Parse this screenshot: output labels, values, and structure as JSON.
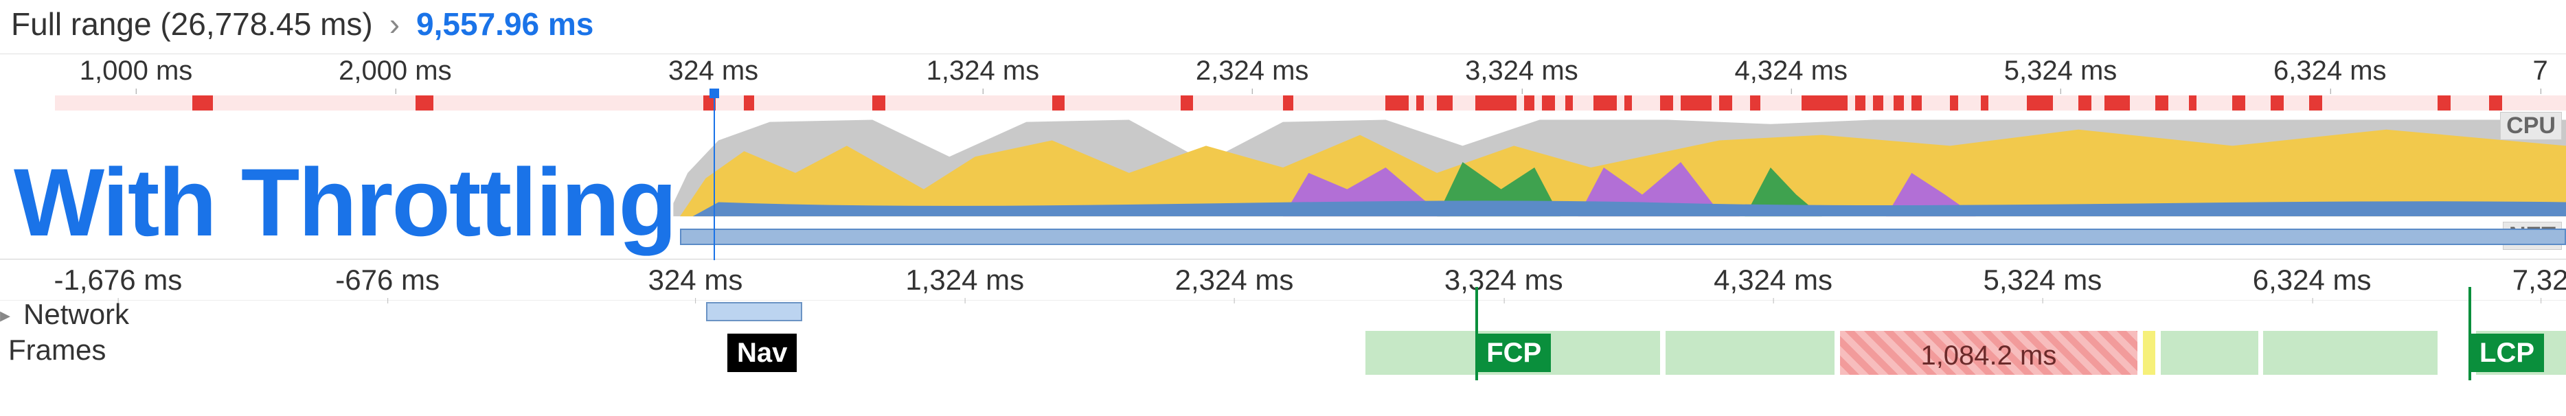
{
  "breadcrumb": {
    "full_range_label": "Full range (26,778.45 ms)",
    "chevron": "›",
    "selection_label": "9,557.96 ms"
  },
  "annotation_text": "With Throttling",
  "overview": {
    "ruler_ticks": [
      {
        "label": "1,000 ms",
        "pct": 5.3
      },
      {
        "label": "2,000 ms",
        "pct": 15.4
      },
      {
        "label": "324 ms",
        "pct": 27.8
      },
      {
        "label": "1,324 ms",
        "pct": 38.3
      },
      {
        "label": "2,324 ms",
        "pct": 48.8
      },
      {
        "label": "3,324 ms",
        "pct": 59.3
      },
      {
        "label": "4,324 ms",
        "pct": 69.8
      },
      {
        "label": "5,324 ms",
        "pct": 80.3
      },
      {
        "label": "6,324 ms",
        "pct": 90.8
      },
      {
        "label": "7",
        "pct": 99.0
      }
    ],
    "cursor_pct": 27.8,
    "cpu_label": "CPU",
    "net_label": "NET",
    "net_bar_start_pct": 26.5,
    "net_bar_end_pct": 100,
    "longtask_marks": [
      {
        "l": 7.5,
        "w": 0.8
      },
      {
        "l": 16.2,
        "w": 0.7
      },
      {
        "l": 27.4,
        "w": 0.5
      },
      {
        "l": 29.0,
        "w": 0.4
      },
      {
        "l": 34.0,
        "w": 0.5
      },
      {
        "l": 41.0,
        "w": 0.5
      },
      {
        "l": 46.0,
        "w": 0.5
      },
      {
        "l": 50.0,
        "w": 0.4
      },
      {
        "l": 54.0,
        "w": 0.9
      },
      {
        "l": 55.2,
        "w": 0.3
      },
      {
        "l": 56.0,
        "w": 0.6
      },
      {
        "l": 57.5,
        "w": 1.6
      },
      {
        "l": 59.4,
        "w": 0.4
      },
      {
        "l": 60.1,
        "w": 0.5
      },
      {
        "l": 61.0,
        "w": 0.3
      },
      {
        "l": 62.1,
        "w": 0.9
      },
      {
        "l": 63.3,
        "w": 0.3
      },
      {
        "l": 64.7,
        "w": 0.5
      },
      {
        "l": 65.5,
        "w": 1.2
      },
      {
        "l": 67.0,
        "w": 0.5
      },
      {
        "l": 68.2,
        "w": 0.4
      },
      {
        "l": 70.2,
        "w": 1.8
      },
      {
        "l": 72.3,
        "w": 0.4
      },
      {
        "l": 73.0,
        "w": 0.4
      },
      {
        "l": 73.8,
        "w": 0.4
      },
      {
        "l": 74.5,
        "w": 0.4
      },
      {
        "l": 76.0,
        "w": 0.3
      },
      {
        "l": 77.2,
        "w": 0.3
      },
      {
        "l": 79.0,
        "w": 1.0
      },
      {
        "l": 81.0,
        "w": 0.5
      },
      {
        "l": 82.0,
        "w": 1.0
      },
      {
        "l": 84.0,
        "w": 0.5
      },
      {
        "l": 85.3,
        "w": 0.3
      },
      {
        "l": 87.0,
        "w": 0.5
      },
      {
        "l": 88.5,
        "w": 0.5
      },
      {
        "l": 90.0,
        "w": 0.5
      },
      {
        "l": 95.0,
        "w": 0.5
      },
      {
        "l": 97.0,
        "w": 0.5
      }
    ]
  },
  "detail": {
    "ruler_ticks": [
      {
        "label": "-1,676 ms",
        "pct": 4.6
      },
      {
        "label": "-676 ms",
        "pct": 15.1
      },
      {
        "label": "324 ms",
        "pct": 27.1
      },
      {
        "label": "1,324 ms",
        "pct": 37.6
      },
      {
        "label": "2,324 ms",
        "pct": 48.1
      },
      {
        "label": "3,324 ms",
        "pct": 58.6
      },
      {
        "label": "4,324 ms",
        "pct": 69.1
      },
      {
        "label": "5,324 ms",
        "pct": 79.6
      },
      {
        "label": "6,324 ms",
        "pct": 90.1
      },
      {
        "label": "7,32",
        "pct": 99.0
      }
    ],
    "network_label": "Network",
    "frames_label": "Frames",
    "nav_badge": "Nav",
    "fcp_badge": "FCP",
    "lcp_badge": "LCP",
    "long_frame_label": "1,084.2 ms",
    "fcp_line_pct": 57.5,
    "lcp_line_pct": 96.2,
    "nav_pct": 28.4,
    "frame_blocks": [
      {
        "cls": "fb-green",
        "l": 53.2,
        "w": 11.5
      },
      {
        "cls": "fb-green",
        "l": 64.9,
        "w": 6.6
      },
      {
        "cls": "fb-red",
        "l": 71.7,
        "w": 11.6,
        "label": true
      },
      {
        "cls": "fb-yellow",
        "l": 83.5,
        "w": 0.5
      },
      {
        "cls": "fb-green",
        "l": 84.2,
        "w": 3.8
      },
      {
        "cls": "fb-green",
        "l": 88.2,
        "w": 6.8
      },
      {
        "cls": "fb-green",
        "l": 96.5,
        "w": 3.5
      }
    ]
  }
}
